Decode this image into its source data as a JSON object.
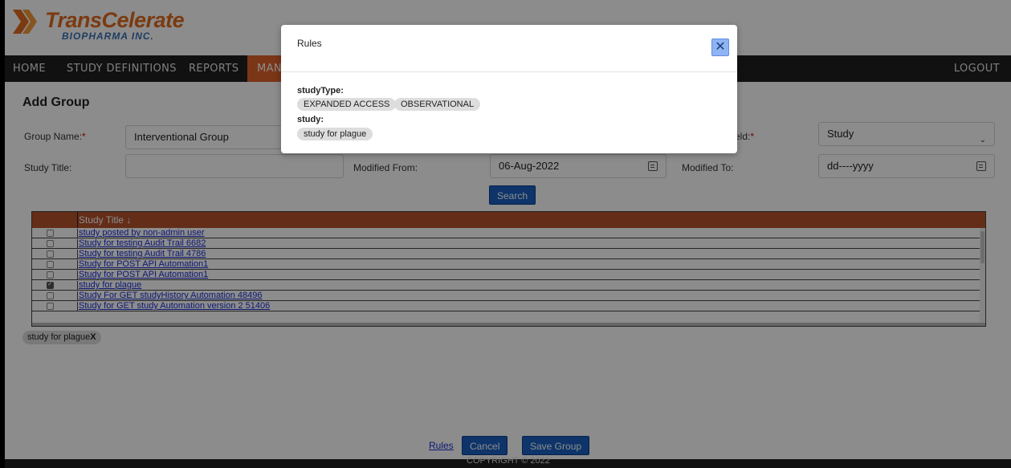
{
  "header": {
    "logo_title": "TransCelerate",
    "logo_subtitle": "BIOPHARMA INC."
  },
  "nav": {
    "items": [
      "HOME",
      "STUDY DEFINITIONS",
      "REPORTS",
      "MANA"
    ],
    "logout": "LOGOUT"
  },
  "form": {
    "page_title": "Add Group",
    "group_name_label": "Group Name:",
    "group_name_value": "Interventional Group",
    "field_label_partial": "eld:",
    "field_select_value": "Study",
    "study_title_label": "Study Title:",
    "study_title_value": "",
    "modified_from_label": "Modified From:",
    "modified_from_value": "06-Aug-2022",
    "modified_to_label": "Modified To:",
    "modified_to_value": "dd----yyyy",
    "search_button": "Search"
  },
  "table": {
    "header": "Study Title ↓",
    "rows": [
      {
        "title": "study posted by non-admin user",
        "checked": false
      },
      {
        "title": "Study for testing Audit Trail 6682",
        "checked": false
      },
      {
        "title": "Study for testing Audit Trail 4786",
        "checked": false
      },
      {
        "title": "Study for POST API Automation1",
        "checked": false
      },
      {
        "title": "Study for POST API Automation1",
        "checked": false
      },
      {
        "title": "study for plague",
        "checked": true
      },
      {
        "title": "Study For GET studyHistory Automation 48496",
        "checked": false
      },
      {
        "title": "Study for GET study Automation version 2 51406",
        "checked": false
      }
    ]
  },
  "selected_chip": {
    "label": "study for plague",
    "remove": "X"
  },
  "actions": {
    "rules_link": "Rules",
    "cancel_button": "Cancel",
    "save_button": "Save Group"
  },
  "footer": {
    "copyright": "COPYRIGHT © 2022"
  },
  "modal": {
    "title": "Rules",
    "close": "✕",
    "rules": [
      {
        "key": "studyType:",
        "values": [
          "EXPANDED ACCESS",
          "OBSERVATIONAL"
        ]
      },
      {
        "key": "study:",
        "values": [
          "study for plague"
        ]
      }
    ]
  },
  "colors": {
    "brand_orange": "#e06b1d",
    "table_header": "#b5532c",
    "primary_button": "#1a5fc1",
    "nav_bg": "#1f1f1f"
  }
}
